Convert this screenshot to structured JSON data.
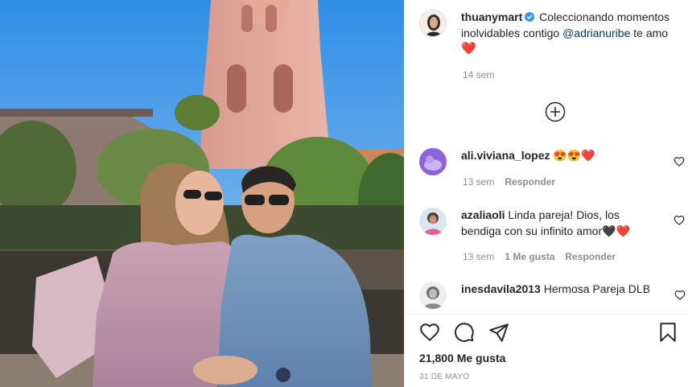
{
  "post": {
    "author": "thuanymart",
    "caption_text": "Coleccionando momentos inolvidables contigo",
    "caption_mention": "@adrianuribe",
    "caption_end": " te amo ",
    "caption_emoji": "❤️",
    "caption_time": "14 sem",
    "verified_color": "#3897f0"
  },
  "comments": [
    {
      "username": "ali.viviana_lopez",
      "text": "😍😍❤️",
      "time": "13 sem",
      "likes_label": "",
      "reply_label": "Responder"
    },
    {
      "username": "azaliaoli",
      "text": "Linda pareja! Dios, los bendiga con su infinito amor🖤❤️",
      "time": "13 sem",
      "likes_label": "1 Me gusta",
      "reply_label": "Responder"
    },
    {
      "username": "inesdavila2013",
      "text": "Hermosa Pareja DLB",
      "time": "",
      "likes_label": "",
      "reply_label": ""
    }
  ],
  "footer": {
    "likes": "21,800 Me gusta",
    "date": "31 DE MAYO"
  },
  "icons": {
    "like": "heart-outline-icon",
    "comment": "comment-bubble-icon",
    "share": "paper-plane-icon",
    "save": "bookmark-icon",
    "load_more": "plus-circle-icon"
  }
}
